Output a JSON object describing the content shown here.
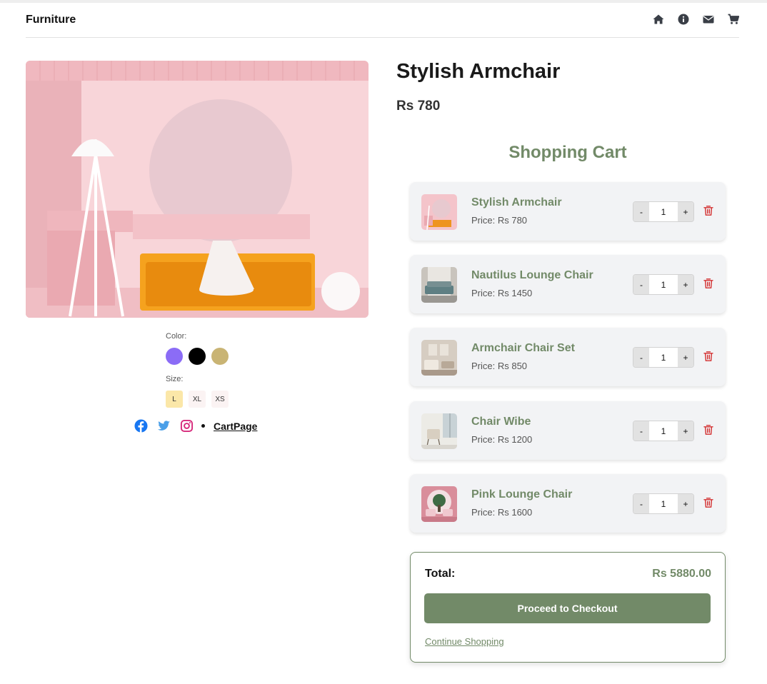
{
  "header": {
    "brand": "Furniture",
    "nav_icons": [
      "home-icon",
      "info-icon",
      "envelope-icon",
      "cart-icon"
    ]
  },
  "product": {
    "title": "Stylish Armchair",
    "price": "Rs 780",
    "color_label": "Color:",
    "colors": [
      "#8b6cf6",
      "#000000",
      "#c9b474"
    ],
    "size_label": "Size:",
    "sizes": [
      "L",
      "XL",
      "XS"
    ],
    "selected_size": "L",
    "social_icons": [
      "facebook-icon",
      "twitter-icon",
      "instagram-icon"
    ],
    "cart_link": "CartPage"
  },
  "cart": {
    "title": "Shopping Cart",
    "items": [
      {
        "name": "Stylish Armchair",
        "price": "Price: Rs 780",
        "qty": "1",
        "minus": "-",
        "plus": "+"
      },
      {
        "name": "Nautilus Lounge Chair",
        "price": "Price: Rs 1450",
        "qty": "1",
        "minus": "-",
        "plus": "+"
      },
      {
        "name": "Armchair Chair Set",
        "price": "Price: Rs 850",
        "qty": "1",
        "minus": "-",
        "plus": "+"
      },
      {
        "name": "Chair Wibe",
        "price": "Price: Rs 1200",
        "qty": "1",
        "minus": "-",
        "plus": "+"
      },
      {
        "name": "Pink Lounge Chair",
        "price": "Price: Rs 1600",
        "qty": "1",
        "minus": "-",
        "plus": "+"
      }
    ],
    "total_label": "Total:",
    "total_value": "Rs 5880.00",
    "checkout_label": "Proceed to Checkout",
    "continue_label": "Continue Shopping"
  },
  "colors": {
    "accent": "#728a68",
    "delete": "#d32f2f"
  }
}
